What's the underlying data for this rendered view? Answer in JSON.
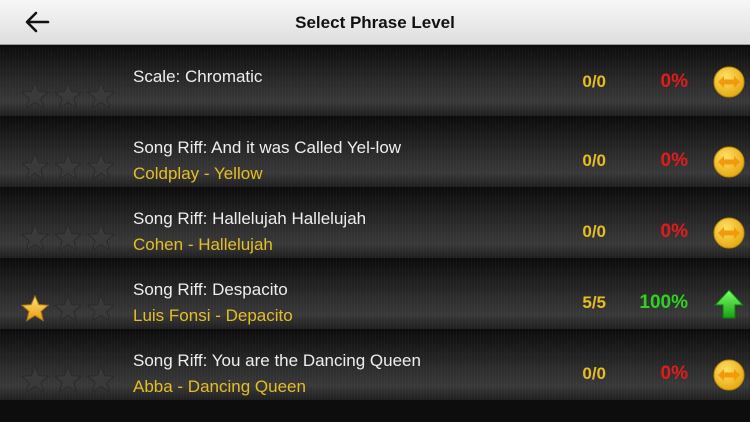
{
  "header": {
    "title": "Select Phrase Level",
    "back_icon": "back-arrow-icon"
  },
  "colors": {
    "artist": "#e6be23",
    "score": "#e6be23",
    "fail": "#e41b1b",
    "pass": "#2fd31f",
    "star_on": "#f4b81a",
    "star_off": "#3a3a3a",
    "nav_badge": "#f2c31a"
  },
  "levels": [
    {
      "name": "Scale: Chromatic",
      "artist": "",
      "score": "0/0",
      "percent": "0%",
      "status": "fail",
      "stars_earned": 0,
      "icon": "left-right-arrow-icon"
    },
    {
      "name": "Song Riff: And it was Called Yel-low",
      "artist": "Coldplay - Yellow",
      "score": "0/0",
      "percent": "0%",
      "status": "fail",
      "stars_earned": 0,
      "icon": "left-right-arrow-icon"
    },
    {
      "name": "Song Riff: Hallelujah Hallelujah",
      "artist": "Cohen - Hallelujah",
      "score": "0/0",
      "percent": "0%",
      "status": "fail",
      "stars_earned": 0,
      "icon": "left-right-arrow-icon"
    },
    {
      "name": "Song Riff: Despacito",
      "artist": "Luis Fonsi - Depacito",
      "score": "5/5",
      "percent": "100%",
      "status": "pass",
      "stars_earned": 1,
      "icon": "up-arrow-icon"
    },
    {
      "name": "Song Riff: You are the Dancing Queen",
      "artist": "Abba - Dancing Queen",
      "score": "0/0",
      "percent": "0%",
      "status": "fail",
      "stars_earned": 0,
      "icon": "left-right-arrow-icon"
    }
  ]
}
